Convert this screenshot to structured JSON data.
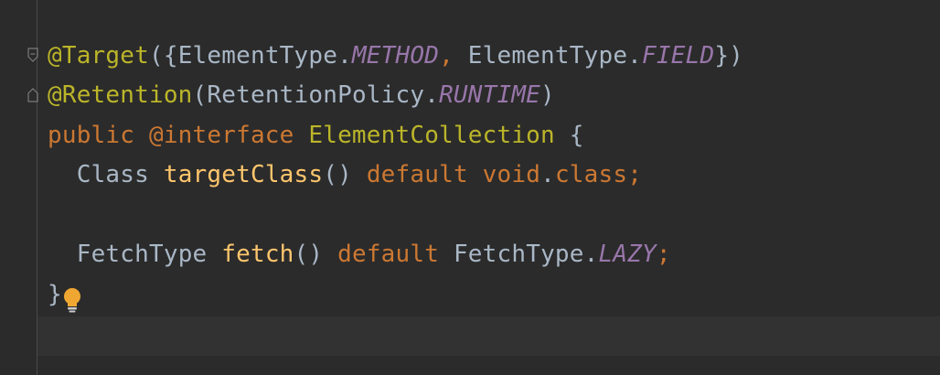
{
  "editor": {
    "line1": {
      "annotation": "@Target",
      "open": "({",
      "type1": "ElementType.",
      "const1": "METHOD",
      "comma": ",",
      "type2": " ElementType.",
      "const2": "FIELD",
      "close": "})"
    },
    "line2": {
      "annotation": "@Retention",
      "open": "(",
      "type": "RetentionPolicy.",
      "const": "RUNTIME",
      "close": ")"
    },
    "line3": {
      "kw_public": "public",
      "kw_interface": " @interface ",
      "name": "ElementCollection",
      "brace": " {"
    },
    "line4": {
      "indent": "  ",
      "type": "Class",
      "space": " ",
      "method": "targetClass",
      "parens": "()",
      "kw_default": " default ",
      "kw_void": "void",
      "dot": ".",
      "kw_class": "class",
      "semicolon": ";"
    },
    "line6": {
      "indent": "  ",
      "type": "FetchType",
      "space": " ",
      "method": "fetch",
      "parens": "()",
      "kw_default": " default ",
      "type2": "FetchType.",
      "const": "LAZY",
      "semicolon": ";"
    },
    "line7": {
      "brace": "}"
    },
    "icons": {
      "fold": "fold-icon",
      "bulb": "lightbulb-icon"
    },
    "colors": {
      "background": "#2b2b2b",
      "annotation": "#bbb529",
      "keyword": "#cc7832",
      "constant": "#9876aa",
      "method": "#ffc66d",
      "text": "#a9b7c6",
      "bulb": "#f0a732"
    }
  }
}
